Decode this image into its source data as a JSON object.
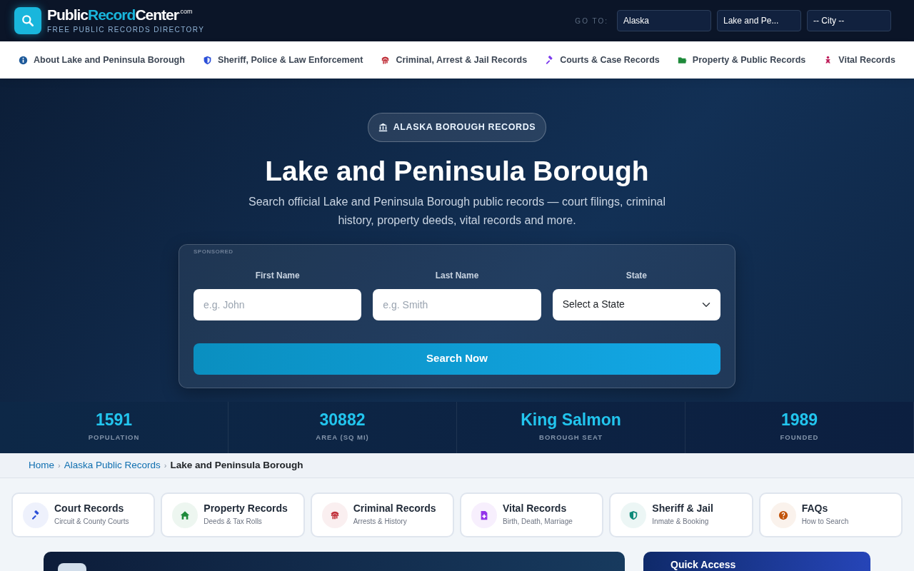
{
  "brand": {
    "part_1": "Public",
    "part_2": "Record",
    "part_3": "Center",
    "suffix": ".com",
    "tagline": "FREE PUBLIC RECORDS DIRECTORY"
  },
  "goto": {
    "label": "GO TO:",
    "selects": [
      "Alaska",
      "Lake and Pe...",
      "-- City --"
    ]
  },
  "nav": [
    {
      "label": "About Lake and Peninsula Borough",
      "kind": "info",
      "color": "#1e5a9a"
    },
    {
      "label": "Sheriff, Police & Law Enforcement",
      "kind": "shield",
      "color": "#2b4fd8"
    },
    {
      "label": "Criminal, Arrest & Jail Records",
      "kind": "fingerprint",
      "color": "#c0303a"
    },
    {
      "label": "Courts & Case Records",
      "kind": "gavel",
      "color": "#7c3aed"
    },
    {
      "label": "Property & Public Records",
      "kind": "folder",
      "color": "#1f8a3b"
    },
    {
      "label": "Vital Records",
      "kind": "baby",
      "color": "#be1e5a"
    }
  ],
  "hero": {
    "badge": "ALASKA BOROUGH RECORDS",
    "title": "Lake and Peninsula Borough",
    "subtitle": "Search official Lake and Peninsula Borough public records — court filings, criminal history, property deeds, vital records and more."
  },
  "search": {
    "sponsored": "SPONSORED",
    "fields": [
      {
        "label": "First Name",
        "kind": "input",
        "placeholder": "e.g. John"
      },
      {
        "label": "Last Name",
        "kind": "input",
        "placeholder": "e.g. Smith"
      },
      {
        "label": "State",
        "kind": "select",
        "value": "Select a State"
      }
    ],
    "button": "Search Now"
  },
  "stats": [
    {
      "value": "1591",
      "label": "POPULATION"
    },
    {
      "value": "30882",
      "label": "AREA (SQ MI)"
    },
    {
      "value": "King Salmon",
      "label": "BOROUGH SEAT"
    },
    {
      "value": "1989",
      "label": "FOUNDED"
    }
  ],
  "breadcrumb": [
    {
      "label": "Home",
      "kind": "link"
    },
    {
      "label": "›",
      "kind": "separator"
    },
    {
      "label": "Alaska Public Records",
      "kind": "link"
    },
    {
      "label": "›",
      "kind": "separator"
    },
    {
      "label": "Lake and Peninsula Borough",
      "kind": "current"
    }
  ],
  "categories": [
    {
      "title": "Court Records",
      "subtitle": "Circuit & County Courts",
      "kind": "gavel",
      "color": "#2b4fd8"
    },
    {
      "title": "Property Records",
      "subtitle": "Deeds & Tax Rolls",
      "kind": "home",
      "color": "#1f8a3b"
    },
    {
      "title": "Criminal Records",
      "subtitle": "Arrests & History",
      "kind": "fingerprint",
      "color": "#c0303a"
    },
    {
      "title": "Vital Records",
      "subtitle": "Birth, Death, Marriage",
      "kind": "file",
      "color": "#9333ea"
    },
    {
      "title": "Sheriff & Jail",
      "subtitle": "Inmate & Booking",
      "kind": "shield",
      "color": "#0f8a7a"
    },
    {
      "title": "FAQs",
      "subtitle": "How to Search",
      "kind": "question",
      "color": "#c2540a"
    }
  ],
  "quick_access": {
    "title": "Quick Access"
  }
}
